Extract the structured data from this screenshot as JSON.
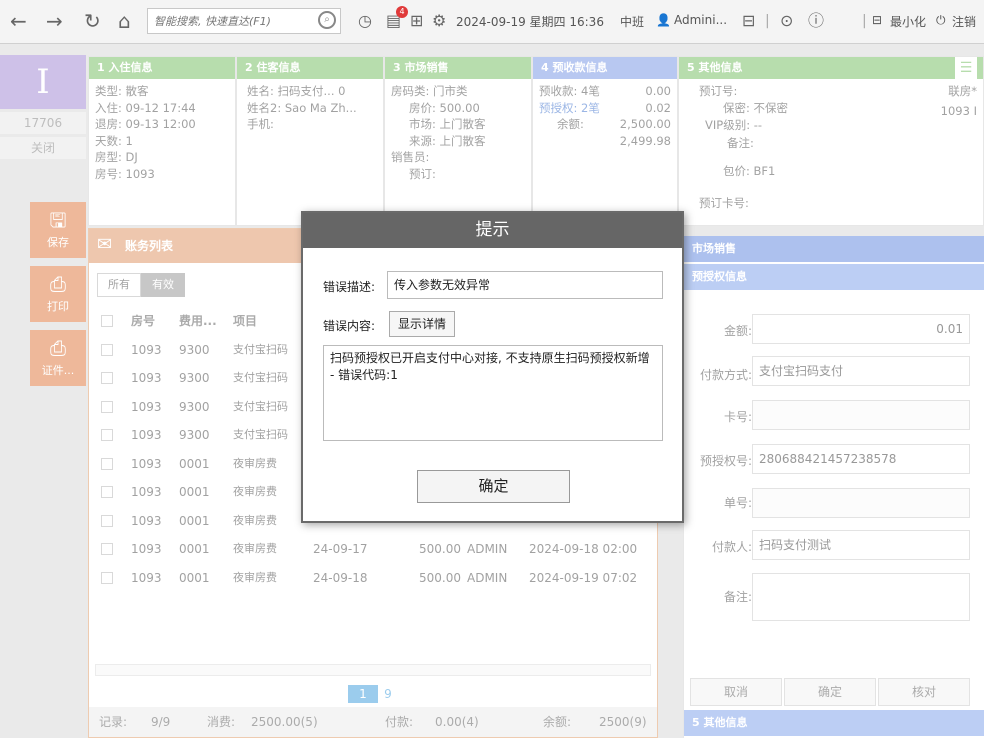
{
  "topbar": {
    "search_placeholder": "智能搜索, 快速直达(F1)",
    "datetime": "2024-09-19 星期四 16:36",
    "shift": "中班",
    "user": "Admini...",
    "badge_count": "4",
    "minimize": "最小化",
    "logout": "注销"
  },
  "rail": {
    "letter": "I",
    "room_no": "17706",
    "close": "关闭",
    "save": "保存",
    "print": "打印",
    "cert": "证件..."
  },
  "panels": {
    "checkin": {
      "title": "1 入住信息",
      "lines": [
        "类型: 散客",
        "入住: 09-12 17:44",
        "退房: 09-13 12:00",
        "天数: 1",
        "房型: DJ",
        "房号: 1093"
      ]
    },
    "guest": {
      "title": "2 住客信息",
      "lines": [
        "姓名: 扫码支付... 0",
        "姓名2: Sao Ma Zh...",
        "手机:"
      ]
    },
    "market": {
      "title": "3 市场销售",
      "lines": [
        "房码类: 门市类",
        "房价: 500.00",
        "市场: 上门散客",
        "来源: 上门散客",
        "销售员:",
        "预订:"
      ]
    },
    "deposit": {
      "title": "4 预收款信息",
      "rows": [
        {
          "label": "预收款: 4笔",
          "value": "0.00"
        },
        {
          "label": "预授权: 2笔",
          "value": "0.02"
        },
        {
          "label": "余额:",
          "value": "2,500.00"
        },
        {
          "label": "",
          "value": "2,499.98"
        }
      ]
    },
    "other": {
      "title": "5 其他信息",
      "lines": [
        "预订号:",
        "保密: 不保密",
        "VIP级别: --",
        "备注:",
        "包价: BF1",
        "预订卡号:"
      ],
      "side": [
        "联房*",
        "1093 I"
      ]
    }
  },
  "accounts": {
    "title": "账务列表",
    "filter_all": "所有",
    "filter_valid": "有效",
    "headers": [
      "房号",
      "费用...",
      "项目"
    ],
    "rows": [
      {
        "room": "1093",
        "code": "9300",
        "item": "支付宝扫码",
        "date": "",
        "amount": "",
        "user": "",
        "time": ""
      },
      {
        "room": "1093",
        "code": "9300",
        "item": "支付宝扫码",
        "date": "",
        "amount": "",
        "user": "",
        "time": ""
      },
      {
        "room": "1093",
        "code": "9300",
        "item": "支付宝扫码",
        "date": "",
        "amount": "",
        "user": "",
        "time": ""
      },
      {
        "room": "1093",
        "code": "9300",
        "item": "支付宝扫码",
        "date": "",
        "amount": "",
        "user": "",
        "time": ""
      },
      {
        "room": "1093",
        "code": "0001",
        "item": "夜审房费",
        "date": "",
        "amount": "",
        "user": "",
        "time": ""
      },
      {
        "room": "1093",
        "code": "0001",
        "item": "夜审房费",
        "date": "",
        "amount": "",
        "user": "",
        "time": ""
      },
      {
        "room": "1093",
        "code": "0001",
        "item": "夜审房费",
        "date": "",
        "amount": "",
        "user": "",
        "time": ""
      },
      {
        "room": "1093",
        "code": "0001",
        "item": "夜审房费",
        "date": "24-09-17",
        "amount": "500.00",
        "user": "ADMIN",
        "time": "2024-09-18 02:00"
      },
      {
        "room": "1093",
        "code": "0001",
        "item": "夜审房费",
        "date": "24-09-18",
        "amount": "500.00",
        "user": "ADMIN",
        "time": "2024-09-19 07:02"
      }
    ],
    "page_current": "1",
    "page_total": "9",
    "status": {
      "records_label": "记录:",
      "records": "9/9",
      "consume_label": "消费:",
      "consume": "2500.00(5)",
      "pay_label": "付款:",
      "pay": "0.00(4)",
      "balance_label": "余额:",
      "balance": "2500(9)"
    }
  },
  "right": {
    "market_title": "市场销售",
    "preauth_title": "预授权信息",
    "amount_label": "金额:",
    "amount": "0.01",
    "pay_method_label": "付款方式:",
    "pay_method": "支付宝扫码支付",
    "card_label": "卡号:",
    "card": "",
    "preauth_no_label": "预授权号:",
    "preauth_no": "280688421457238578",
    "bill_label": "单号:",
    "bill": "",
    "payer_label": "付款人:",
    "payer": "扫码支付测试",
    "remark_label": "备注:",
    "remark": "",
    "cancel": "取消",
    "confirm": "确定",
    "verify": "核对",
    "other_title": "5 其他信息"
  },
  "modal": {
    "title": "提示",
    "desc_label": "错误描述:",
    "desc": "传入参数无效异常",
    "content_label": "错误内容:",
    "detail_button": "显示详情",
    "message": "扫码预授权已开启支付中心对接, 不支持原生扫码预授权新增 - 错误代码:1",
    "ok": "确定"
  }
}
